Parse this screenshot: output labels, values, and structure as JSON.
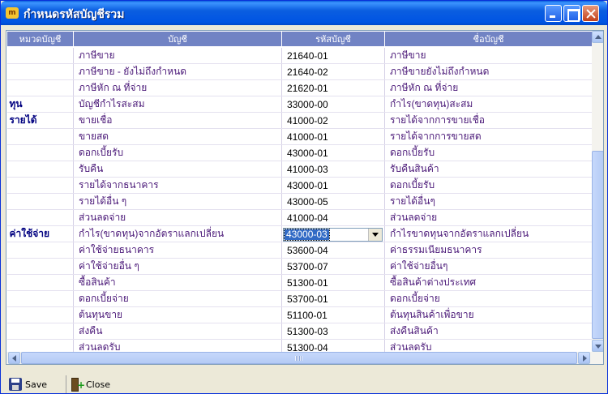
{
  "window": {
    "icon_text": "m",
    "title": "กำหนดรหัสบัญชีรวม"
  },
  "grid": {
    "columns": [
      "หมวดบัญชี",
      "บัญชี",
      "รหัสบัญชี",
      "ชื่อบัญชี"
    ],
    "rows": [
      {
        "category": "",
        "account": "ภาษีขาย",
        "code": "21640-01",
        "name": "ภาษีขาย"
      },
      {
        "category": "",
        "account": "ภาษีขาย - ยังไม่ถึงกำหนด",
        "code": "21640-02",
        "name": "ภาษีขายยังไม่ถึงกำหนด"
      },
      {
        "category": "",
        "account": "ภาษีหัก ณ ที่จ่าย",
        "code": "21620-01",
        "name": "ภาษีหัก ณ ที่จ่าย"
      },
      {
        "category": "ทุน",
        "account": "บัญชีกำไรสะสม",
        "code": "33000-00",
        "name": "กำไร(ขาดทุน)สะสม"
      },
      {
        "category": "รายได้",
        "account": "ขายเชื่อ",
        "code": "41000-02",
        "name": "รายได้จากการขายเชื่อ"
      },
      {
        "category": "",
        "account": "ขายสด",
        "code": "41000-01",
        "name": "รายได้จากการขายสด"
      },
      {
        "category": "",
        "account": "ดอกเบี้ยรับ",
        "code": "43000-01",
        "name": "ดอกเบี้ยรับ"
      },
      {
        "category": "",
        "account": "รับคืน",
        "code": "41000-03",
        "name": "รับคืนสินค้า"
      },
      {
        "category": "",
        "account": "รายได้จากธนาคาร",
        "code": "43000-01",
        "name": "ดอกเบี้ยรับ"
      },
      {
        "category": "",
        "account": "รายได้อื่น ๆ",
        "code": "43000-05",
        "name": "รายได้อื่นๆ"
      },
      {
        "category": "",
        "account": "ส่วนลดจ่าย",
        "code": "41000-04",
        "name": "ส่วนลดจ่าย"
      },
      {
        "category": "ค่าใช้จ่าย",
        "account": "กำไร(ขาดทุน)จากอัตราแลกเปลี่ยน",
        "code": "43000-03",
        "name": "กำไรขาดทุนจากอัตราแลกเปลี่ยน"
      },
      {
        "category": "",
        "account": "ค่าใช้จ่ายธนาคาร",
        "code": "53600-04",
        "name": "ค่าธรรมเนียมธนาคาร"
      },
      {
        "category": "",
        "account": "ค่าใช้จ่ายอื่น ๆ",
        "code": "53700-07",
        "name": "ค่าใช้จ่ายอื่นๆ"
      },
      {
        "category": "",
        "account": "ซื้อสินค้า",
        "code": "51300-01",
        "name": "ซื้อสินค้าต่างประเทศ"
      },
      {
        "category": "",
        "account": "ดอกเบี้ยจ่าย",
        "code": "53700-01",
        "name": "ดอกเบี้ยจ่าย"
      },
      {
        "category": "",
        "account": "ต้นทุนขาย",
        "code": "51100-01",
        "name": "ต้นทุนสินค้าเพื่อขาย"
      },
      {
        "category": "",
        "account": "ส่งคืน",
        "code": "51300-03",
        "name": "ส่งคืนสินค้า"
      },
      {
        "category": "",
        "account": "ส่วนลดรับ",
        "code": "51300-04",
        "name": "ส่วนลดรับ"
      }
    ],
    "selected_row": 11
  },
  "toolbar": {
    "save_label": "Save",
    "close_label": "Close"
  }
}
